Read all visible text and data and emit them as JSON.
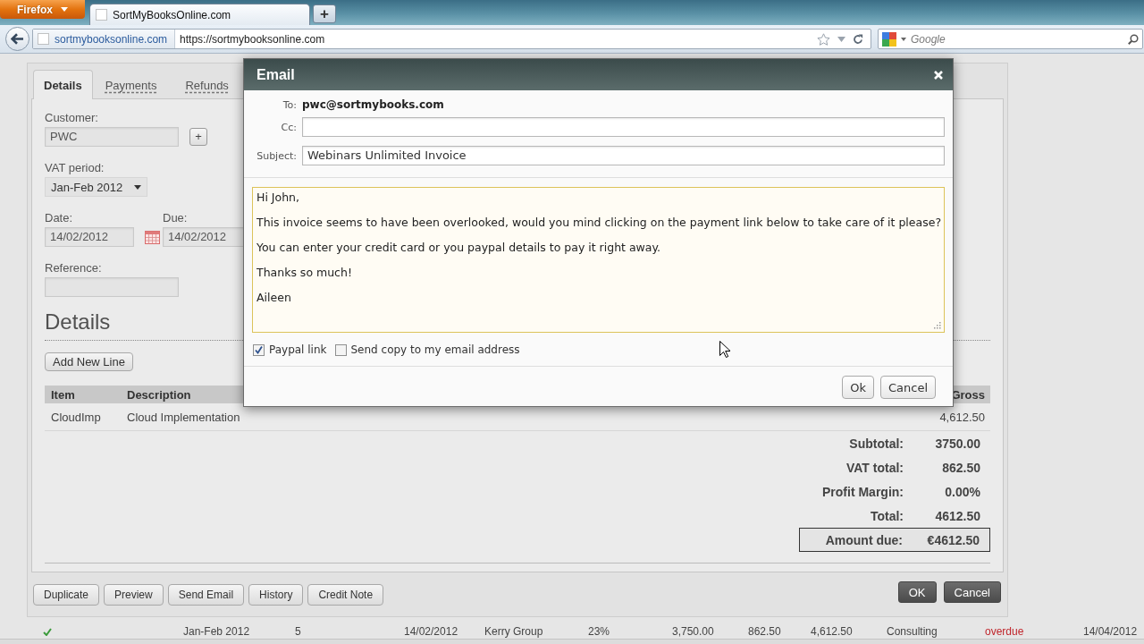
{
  "browser": {
    "menu_button": "Firefox",
    "tabs": [
      {
        "title": "SortMyBooksOnline.com",
        "selected": true
      }
    ],
    "new_tab_button": "+",
    "site_identity": "sortmybooksonline.com",
    "url": "https://sortmybooksonline.com",
    "search": {
      "placeholder": "Google"
    }
  },
  "invoice": {
    "tabs": [
      {
        "label": "Details",
        "selected": true
      },
      {
        "label": "Payments",
        "selected": false
      },
      {
        "label": "Refunds",
        "selected": false
      }
    ],
    "customer": {
      "label": "Customer:",
      "value": "PWC",
      "add_button": "+"
    },
    "vat_period": {
      "label": "VAT period:",
      "value": "Jan-Feb 2012"
    },
    "date": {
      "label": "Date:",
      "value": "14/02/2012"
    },
    "due": {
      "label": "Due:",
      "value": "14/02/2012"
    },
    "reference": {
      "label": "Reference:"
    },
    "section_title": "Details",
    "add_line_button": "Add New Line",
    "table": {
      "columns": [
        "Item",
        "Description",
        "Gross"
      ],
      "rows": [
        [
          "CloudImp",
          "Cloud Implementation",
          "4,612.50"
        ]
      ]
    },
    "totals": [
      {
        "label": "Subtotal:",
        "value": "3750.00",
        "kind": "plain"
      },
      {
        "label": "VAT total:",
        "value": "862.50",
        "kind": "plain"
      },
      {
        "label": "Profit Margin:",
        "value": "0.00%",
        "kind": "plain"
      },
      {
        "label": "Total:",
        "value": "4612.50",
        "kind": "plain"
      },
      {
        "label": "Amount due:",
        "value": "€4612.50",
        "kind": "boxed"
      }
    ],
    "action_buttons": [
      "Duplicate",
      "Preview",
      "Send Email",
      "History",
      "Credit Note"
    ],
    "footer_buttons": [
      "OK",
      "Cancel"
    ]
  },
  "list_row": {
    "cells": [
      {
        "text": "Jan-Feb 2012",
        "kind": "text"
      },
      {
        "text": "5",
        "kind": "text"
      },
      {
        "text": "14/02/2012",
        "kind": "text"
      },
      {
        "text": "Kerry Group",
        "kind": "text"
      },
      {
        "text": "23%",
        "kind": "text"
      },
      {
        "text": "3,750.00",
        "kind": "text"
      },
      {
        "text": "862.50",
        "kind": "text"
      },
      {
        "text": "4,612.50",
        "kind": "text"
      },
      {
        "text": "Consulting",
        "kind": "text"
      },
      {
        "text": "overdue",
        "kind": "status"
      },
      {
        "text": "14/04/2012",
        "kind": "text"
      }
    ]
  },
  "email_dialog": {
    "title": "Email",
    "to": {
      "label": "To:",
      "value": "pwc@sortmybooks.com"
    },
    "cc": {
      "label": "Cc:"
    },
    "subject": {
      "label": "Subject:",
      "value": "Webinars Unlimited Invoice"
    },
    "message": [
      "Hi John,",
      "This invoice seems to have been overlooked, would you mind clicking on the payment link below to take care of it please?",
      "You can enter your credit card or you paypal details to pay it right away.",
      "Thanks so much!",
      "Aileen"
    ],
    "options": [
      {
        "label": "Paypal link",
        "checked": true
      },
      {
        "label": "Send copy to my email address",
        "checked": false
      }
    ],
    "buttons": [
      "Ok",
      "Cancel"
    ]
  }
}
